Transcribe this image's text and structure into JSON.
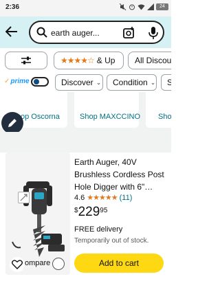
{
  "status_bar": {
    "time": "2:36",
    "icons": [
      "mute-icon",
      "alarm-icon",
      "wifi-icon",
      "signal-icon"
    ],
    "battery": "24"
  },
  "header": {
    "search_value": "earth auger...",
    "background_color": "#d6f1f3"
  },
  "filters_row1": {
    "stars_label": "& Up",
    "all_discounts_label": "All Discou"
  },
  "filters_row2": {
    "prime_label": "prime",
    "discover_label": "Discover",
    "condition_label": "Condition",
    "more_label": "S"
  },
  "shops": [
    {
      "label": "op Oscorna"
    },
    {
      "label": "Shop MAXCCINO"
    },
    {
      "label": "Shop"
    }
  ],
  "product": {
    "title": "Earth Auger, 40V Brushless Cordless Post Hole Digger with 6\"…",
    "rating": "4.6",
    "rating_stars": 4.6,
    "rating_count": "(11)",
    "price_symbol": "$",
    "price_whole": "229",
    "price_fraction": "95",
    "delivery": "FREE delivery",
    "stock": "Temporarily out of stock.",
    "add_to_cart": "Add to cart",
    "compare_label": "ompare"
  },
  "colors": {
    "accent_orange": "#de7921",
    "link": "#007185",
    "cart_button": "#ffd814",
    "prime_blue": "#1a98ff"
  }
}
